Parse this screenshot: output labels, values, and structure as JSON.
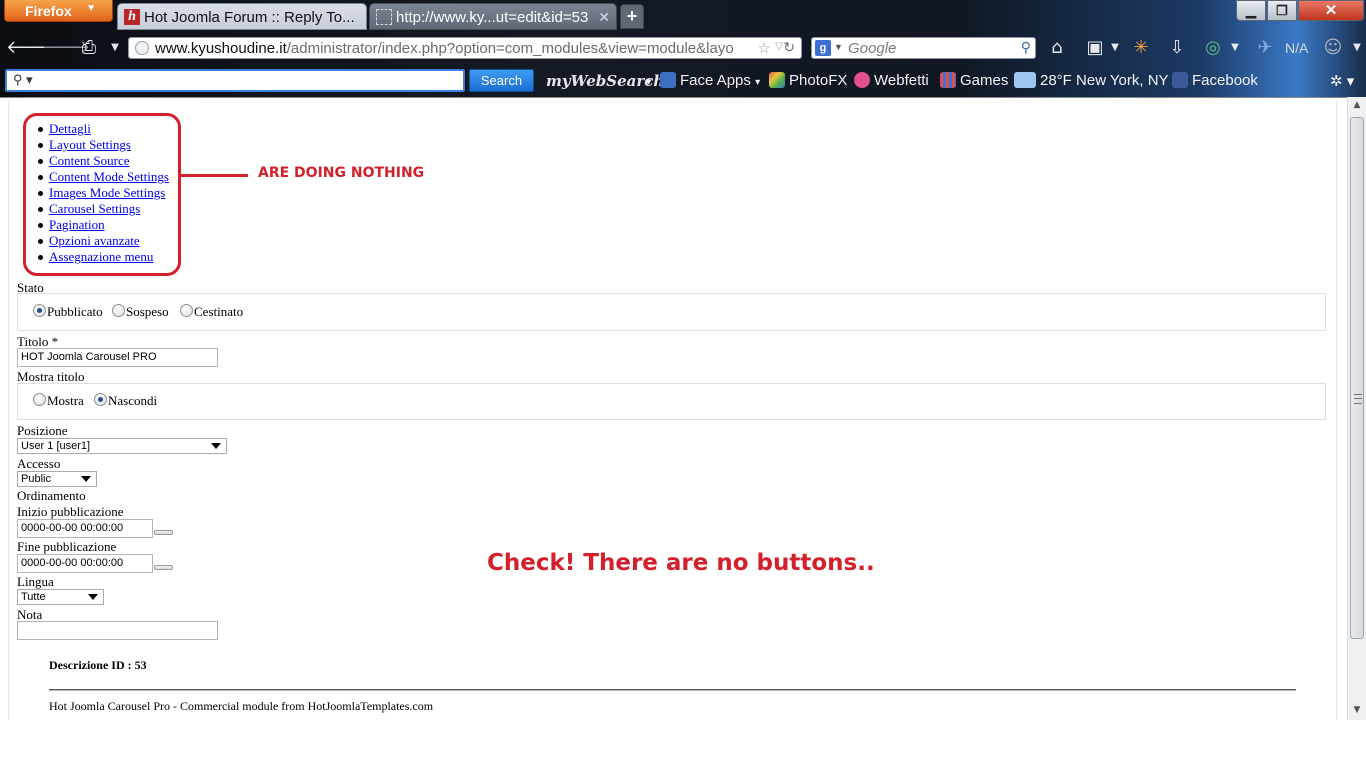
{
  "browser": {
    "app_button": "Firefox",
    "tabs": [
      {
        "title": "Hot Joomla Forum :: Reply To...",
        "favicon": "h"
      },
      {
        "title": "http://www.ky...ut=edit&id=53"
      }
    ],
    "new_tab": "+",
    "url_host": "www.kyushoudine.it",
    "url_path": "/administrator/index.php?option=com_modules&view=module&layo",
    "search_placeholder": "Google",
    "search_engine_icon": "g-plus-icon",
    "weather_badge": "N/A"
  },
  "toolbar": {
    "search_value": "",
    "search_button": "Search",
    "logo": "myWebSearch",
    "items": [
      "Face Apps",
      "PhotoFX",
      "Webfetti",
      "Games",
      "28°F New York, NY",
      "Facebook"
    ]
  },
  "module_nav": {
    "items": [
      "Dettagli",
      "Layout Settings",
      "Content Source",
      "Content Mode Settings",
      "Images Mode Settings",
      "Carousel Settings",
      "Pagination",
      "Opzioni avanzate",
      "Assegnazione menu"
    ]
  },
  "annotations": {
    "nav_note": "ARE DOING NOTHING",
    "main_note": "Check! There are no buttons.."
  },
  "form": {
    "stato_label": "Stato",
    "stato_options": [
      "Pubblicato",
      "Sospeso",
      "Cestinato"
    ],
    "stato_selected": "Pubblicato",
    "titolo_label": "Titolo *",
    "titolo_value": "HOT Joomla Carousel PRO",
    "mostra_titolo_label": "Mostra titolo",
    "mostra_titolo_options": [
      "Mostra",
      "Nascondi"
    ],
    "mostra_titolo_selected": "Nascondi",
    "posizione_label": "Posizione",
    "posizione_value": "User 1 [user1]",
    "accesso_label": "Accesso",
    "accesso_value": "Public",
    "ordinamento_label": "Ordinamento",
    "inizio_label": "Inizio pubblicazione",
    "inizio_value": "0000-00-00 00:00:00",
    "fine_label": "Fine pubblicazione",
    "fine_value": "0000-00-00 00:00:00",
    "lingua_label": "Lingua",
    "lingua_value": "Tutte",
    "nota_label": "Nota",
    "nota_value": ""
  },
  "description": {
    "title": "Descrizione ID : 53",
    "text": "Hot Joomla Carousel Pro - Commercial module from HotJoomlaTemplates.com"
  }
}
